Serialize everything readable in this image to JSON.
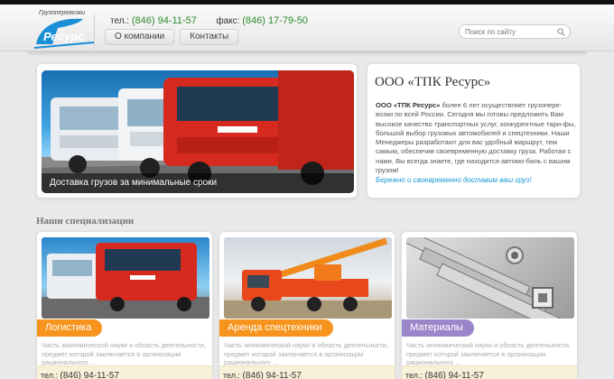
{
  "colors": {
    "accent_green": "#2e8a2e",
    "logo_blue": "#1a8fd6",
    "tab_orange": "#f7941d",
    "tab_lilac": "#9b86c9",
    "slogan_blue": "#1a9ad6"
  },
  "header": {
    "logo_caption": "Грузоперевозки",
    "logo_text": "Ресурс",
    "phone_label": "тел.:",
    "phone": "(846) 94-11-57",
    "fax_label": "факс:",
    "fax": "(846) 17-79-50",
    "nav": [
      "О компании",
      "Контакты"
    ],
    "search_placeholder": "Поиск по сайту",
    "search_icon": "search-icon"
  },
  "hero": {
    "caption": "Доставка грузов за минимальные сроки"
  },
  "about": {
    "title": "ООО «ТПК Ресурс»",
    "company": "ООО «ТПК Ресурс»",
    "text": " более 6 лет осуществляет грузопере-возки по всей России. Сегодня мы готовы предложить Вам высокое качество транспортных услуг, конкурентные тари-фы, большой выбор грузовых автомобилей и спецтехники. Наши Менеджеры разработают для вас удобный маршрут, тем самым, обеспечив своевременную доставку груза. Работая с нами, Вы всегда знаете, где находится автомо-биль с вашим грузом!",
    "slogan": "Бережно и своевременно доставим ваш груз!"
  },
  "specializations": {
    "title": "Наши специализации",
    "cards": [
      {
        "title": "Логистика",
        "color": "#f7941d",
        "text": "Часть экономической науки и область деятельности, предмет которой заключается в организации рационального ...",
        "phone_label": "тел.:",
        "phone": "(846) 94-11-57"
      },
      {
        "title": "Аренда спецтехники",
        "color": "#f7941d",
        "text": "Часть экономической науки и область деятельности, предмет которой заключается в организации рационального ...",
        "phone_label": "тел.:",
        "phone": "(846) 94-11-57"
      },
      {
        "title": "Материалы",
        "color": "#9b86c9",
        "text": "Часть экономической науки и область деятельности, предмет которой заключается в организации рационального ...",
        "phone_label": "тел.:",
        "phone": "(846) 94-11-57"
      }
    ]
  }
}
